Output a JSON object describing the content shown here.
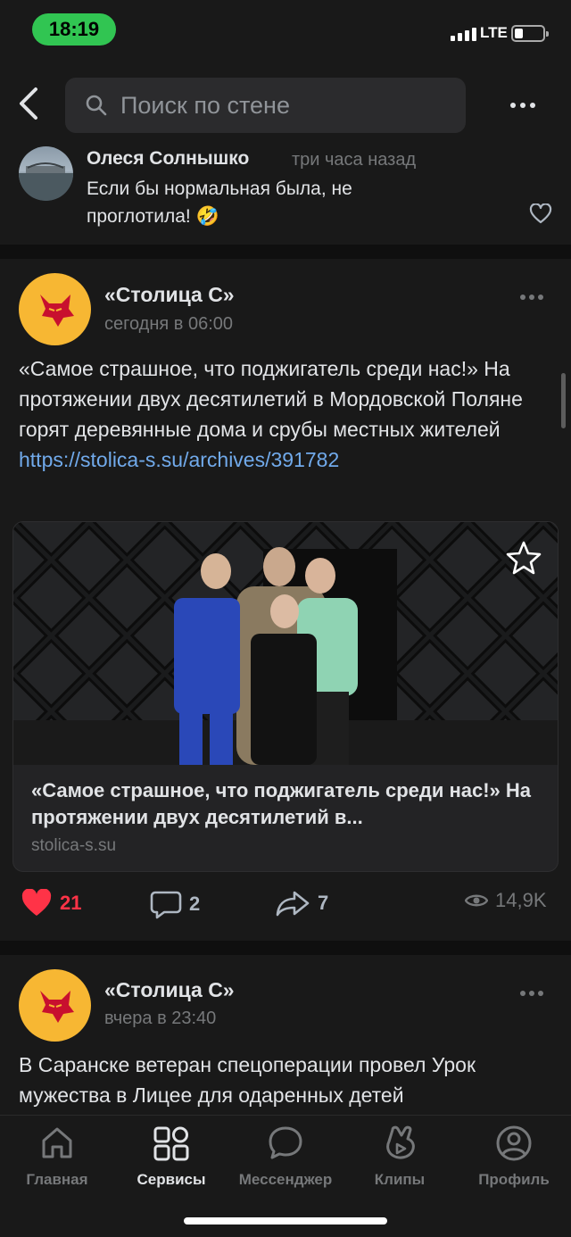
{
  "status": {
    "time": "18:19",
    "network": "LTE",
    "battery_level": 0.3,
    "signal_bars": 4
  },
  "header": {
    "search_placeholder": "Поиск по стене"
  },
  "comment": {
    "author": "Олеся Солнышко",
    "time": "три часа назад",
    "text": "Если бы нормальная была, не проглотила! 🤣"
  },
  "posts": [
    {
      "author": "«Столица С»",
      "time": "сегодня в 06:00",
      "text": "«Самое страшное, что поджигатель среди нас!» На протяжении двух десятилетий в Мордовской Поляне горят деревянные дома и срубы местных жителей",
      "link": "https://stolica-s.su/archives/391782",
      "card": {
        "title": "«Самое страшное, что поджигатель среди нас!» На протяжении двух десятилетий в...",
        "domain": "stolica-s.su"
      },
      "likes": "21",
      "comments": "2",
      "shares": "7",
      "views": "14,9K"
    },
    {
      "author": "«Столица С»",
      "time": "вчера в 23:40",
      "text": "В Саранске ветеран спецоперации провел Урок мужества в Лицее для одаренных детей"
    }
  ],
  "tabs": [
    {
      "label": "Главная",
      "icon": "home-icon"
    },
    {
      "label": "Сервисы",
      "icon": "services-icon",
      "active": true
    },
    {
      "label": "Мессенджер",
      "icon": "messenger-icon"
    },
    {
      "label": "Клипы",
      "icon": "clips-icon"
    },
    {
      "label": "Профиль",
      "icon": "profile-icon"
    }
  ],
  "colors": {
    "accent_like": "#ff3347",
    "link": "#71aaeb",
    "avatar_bg": "#f7b733",
    "status_pill": "#31c552"
  }
}
